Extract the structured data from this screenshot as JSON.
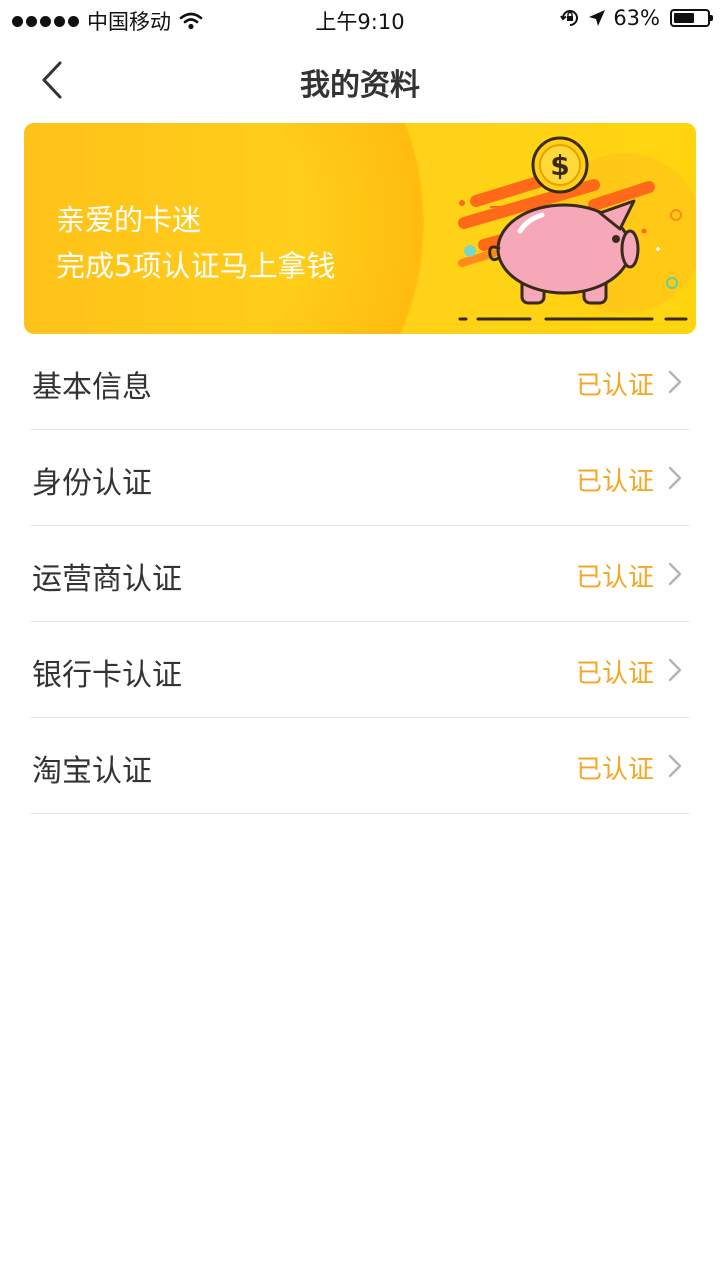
{
  "status_bar": {
    "carrier": "中国移动",
    "time": "上午9:10",
    "battery_percent": "63%",
    "battery_level": 0.63
  },
  "nav": {
    "title": "我的资料"
  },
  "banner": {
    "line1": "亲爱的卡迷",
    "line2": "完成5项认证马上拿钱"
  },
  "items": [
    {
      "label": "基本信息",
      "status": "已认证"
    },
    {
      "label": "身份认证",
      "status": "已认证"
    },
    {
      "label": "运营商认证",
      "status": "已认证"
    },
    {
      "label": "银行卡认证",
      "status": "已认证"
    },
    {
      "label": "淘宝认证",
      "status": "已认证"
    }
  ],
  "colors": {
    "accent": "#f5a623",
    "banner_yellow": "#ffcc11",
    "piggy_pink": "#f6a8b8"
  },
  "icons": {
    "back": "chevron-left-icon",
    "row_arrow": "chevron-right-icon",
    "wifi": "wifi-icon",
    "orientation_lock": "orientation-lock-icon",
    "location": "location-arrow-icon",
    "battery": "battery-icon"
  }
}
